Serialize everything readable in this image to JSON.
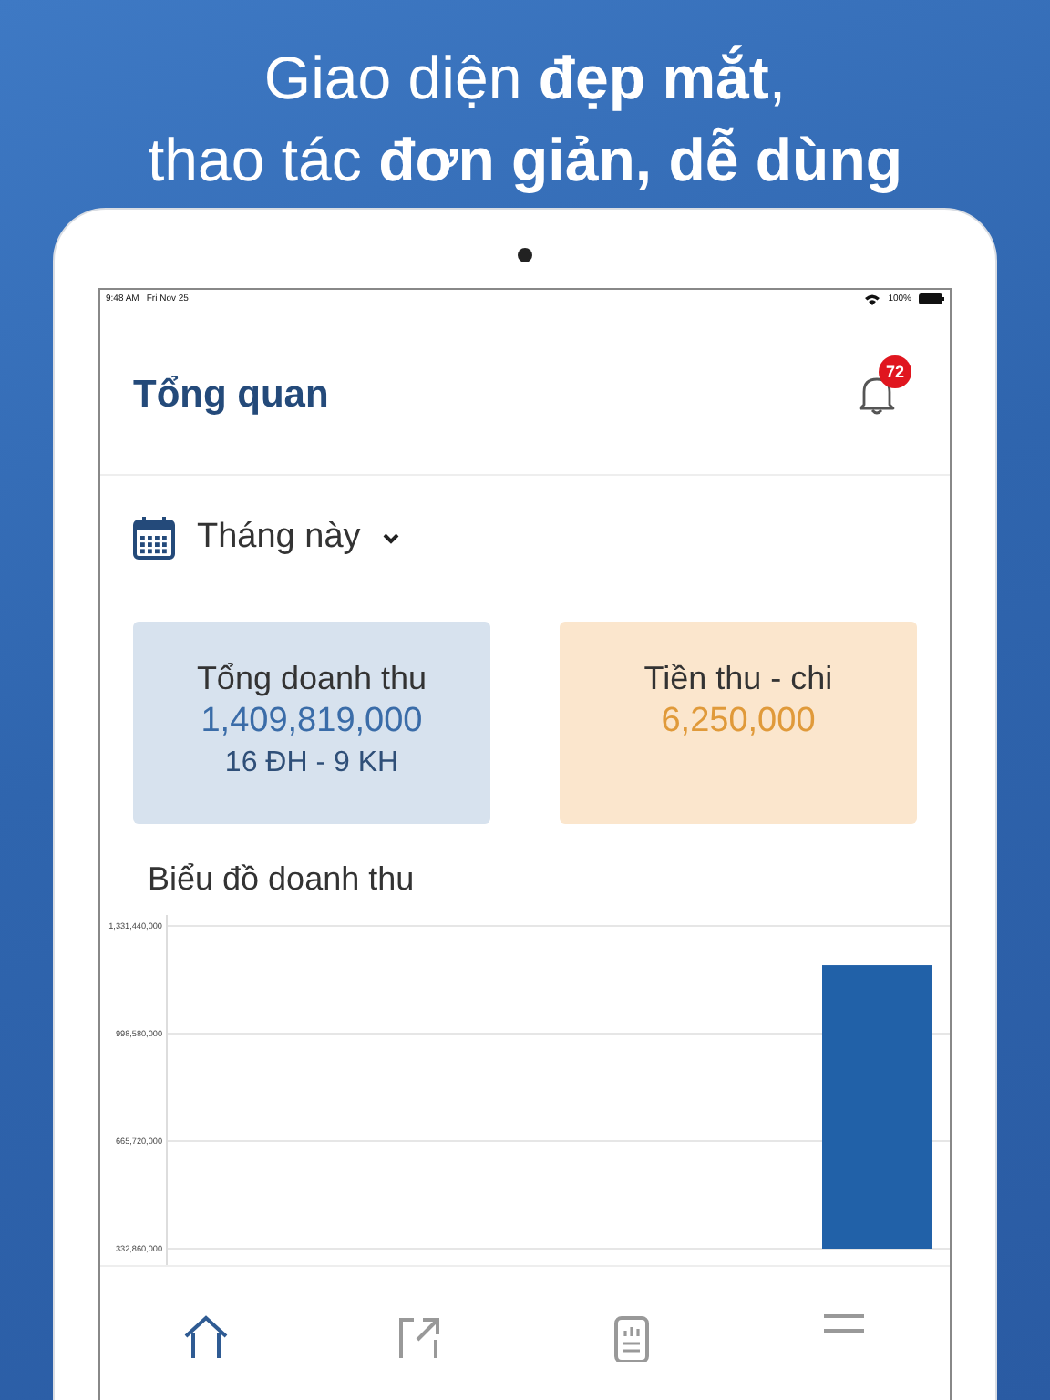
{
  "headline": [
    "Giao diện **đẹp mắt**,",
    "thao tác **đơn giản, dễ dùng**"
  ],
  "status_bar": {
    "time": "9:48 AM",
    "date": "Fri Nov 25",
    "battery": "100%"
  },
  "header": {
    "title": "Tổng quan",
    "badge": "72"
  },
  "period": {
    "label": "Tháng này"
  },
  "cards": [
    {
      "kind": "revenue",
      "title": "Tổng doanh thu",
      "value": "1,409,819,000",
      "detail": "16 ĐH - 9 KH"
    },
    {
      "kind": "cashflow",
      "title": "Tiền thu - chi",
      "value": "6,250,000"
    }
  ],
  "chart": {
    "title": "Biểu đồ doanh thu",
    "chart_data": {
      "type": "bar",
      "values": [
        1210000000
      ],
      "ylim": [
        332860000,
        1331440000
      ],
      "yticks": [
        {
          "value": 1331440000,
          "label": "1,331,440,000"
        },
        {
          "value": 998580000,
          "label": "998,580,000"
        },
        {
          "value": 665720000,
          "label": "665,720,000"
        },
        {
          "value": 332860000,
          "label": "332,860,000"
        }
      ],
      "color": "#2161a8"
    }
  },
  "tab_bar": [
    {
      "kind": "home",
      "selected": true
    },
    {
      "kind": "export",
      "selected": false
    },
    {
      "kind": "report",
      "selected": false
    },
    {
      "kind": "menu",
      "selected": false
    }
  ]
}
